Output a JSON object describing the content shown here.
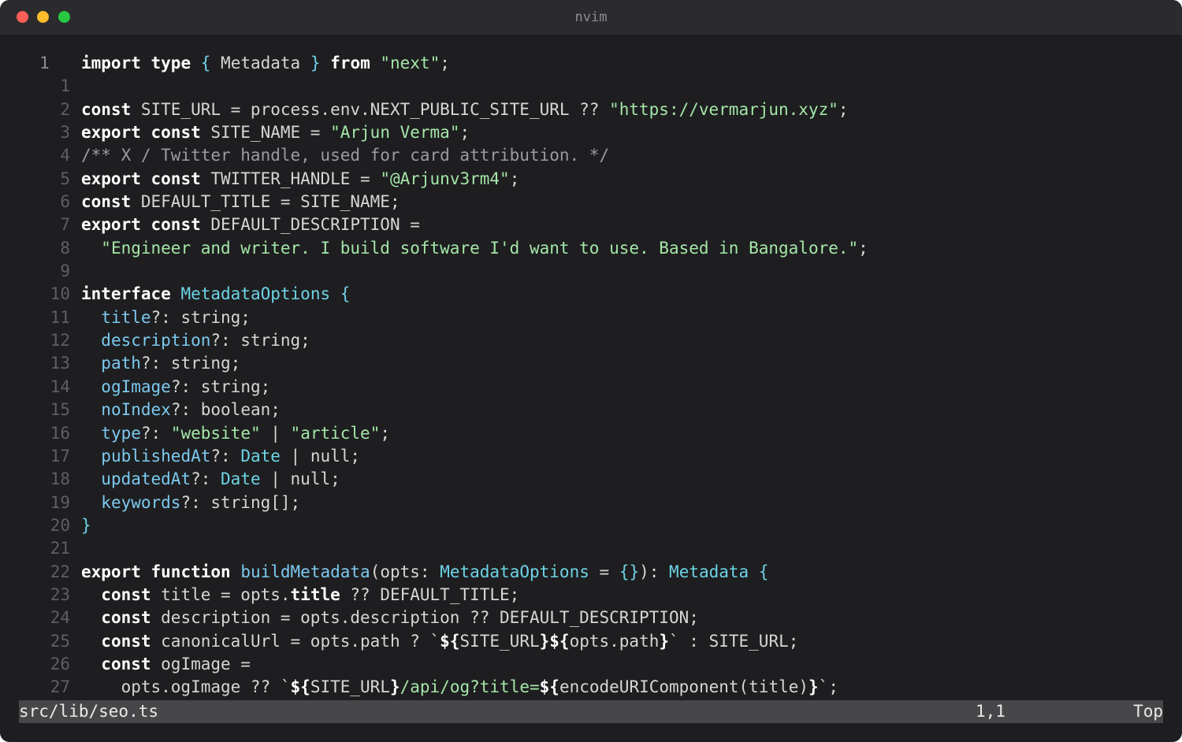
{
  "window": {
    "title": "nvim"
  },
  "editor": {
    "lines": [
      {
        "ln": "1",
        "parts": [
          [
            "kw",
            "import"
          ],
          [
            "",
            " "
          ],
          [
            "kw",
            "type"
          ],
          [
            "",
            " "
          ],
          [
            "br",
            "{"
          ],
          [
            "",
            " Metadata "
          ],
          [
            "br",
            "}"
          ],
          [
            "",
            " "
          ],
          [
            "kw",
            "from"
          ],
          [
            "",
            " "
          ],
          [
            "str",
            "\"next\""
          ],
          [
            "",
            ";"
          ]
        ]
      },
      {
        "ln": "1",
        "parts": []
      },
      {
        "ln": "2",
        "parts": [
          [
            "kw",
            "const"
          ],
          [
            "",
            " SITE_URL = process.env.NEXT_PUBLIC_SITE_URL ?? "
          ],
          [
            "str",
            "\"https://vermarjun.xyz\""
          ],
          [
            "",
            ";"
          ]
        ]
      },
      {
        "ln": "3",
        "parts": [
          [
            "kw",
            "export"
          ],
          [
            "",
            " "
          ],
          [
            "kw",
            "const"
          ],
          [
            "",
            " SITE_NAME = "
          ],
          [
            "str",
            "\"Arjun Verma\""
          ],
          [
            "",
            ";"
          ]
        ]
      },
      {
        "ln": "4",
        "parts": [
          [
            "cm",
            "/** X / Twitter handle, used for card attribution. */"
          ]
        ]
      },
      {
        "ln": "5",
        "parts": [
          [
            "kw",
            "export"
          ],
          [
            "",
            " "
          ],
          [
            "kw",
            "const"
          ],
          [
            "",
            " TWITTER_HANDLE = "
          ],
          [
            "str",
            "\"@Arjunv3rm4\""
          ],
          [
            "",
            ";"
          ]
        ]
      },
      {
        "ln": "6",
        "parts": [
          [
            "kw",
            "const"
          ],
          [
            "",
            " DEFAULT_TITLE = SITE_NAME;"
          ]
        ]
      },
      {
        "ln": "7",
        "parts": [
          [
            "kw",
            "export"
          ],
          [
            "",
            " "
          ],
          [
            "kw",
            "const"
          ],
          [
            "",
            " DEFAULT_DESCRIPTION ="
          ]
        ]
      },
      {
        "ln": "8",
        "parts": [
          [
            "",
            "  "
          ],
          [
            "str",
            "\"Engineer and writer. I build software I'd want to use. Based in Bangalore.\""
          ],
          [
            "",
            ";"
          ]
        ]
      },
      {
        "ln": "9",
        "parts": []
      },
      {
        "ln": "10",
        "parts": [
          [
            "kw",
            "interface"
          ],
          [
            "",
            " "
          ],
          [
            "ty",
            "MetadataOptions"
          ],
          [
            "",
            " "
          ],
          [
            "br",
            "{"
          ]
        ]
      },
      {
        "ln": "11",
        "parts": [
          [
            "",
            "  "
          ],
          [
            "prop",
            "title"
          ],
          [
            "",
            "?: string;"
          ]
        ]
      },
      {
        "ln": "12",
        "parts": [
          [
            "",
            "  "
          ],
          [
            "prop",
            "description"
          ],
          [
            "",
            "?: string;"
          ]
        ]
      },
      {
        "ln": "13",
        "parts": [
          [
            "",
            "  "
          ],
          [
            "prop",
            "path"
          ],
          [
            "",
            "?: string;"
          ]
        ]
      },
      {
        "ln": "14",
        "parts": [
          [
            "",
            "  "
          ],
          [
            "prop",
            "ogImage"
          ],
          [
            "",
            "?: string;"
          ]
        ]
      },
      {
        "ln": "15",
        "parts": [
          [
            "",
            "  "
          ],
          [
            "prop",
            "noIndex"
          ],
          [
            "",
            "?: boolean;"
          ]
        ]
      },
      {
        "ln": "16",
        "parts": [
          [
            "",
            "  "
          ],
          [
            "prop",
            "type"
          ],
          [
            "",
            "?: "
          ],
          [
            "str",
            "\"website\""
          ],
          [
            "",
            " | "
          ],
          [
            "str",
            "\"article\""
          ],
          [
            "",
            ";"
          ]
        ]
      },
      {
        "ln": "17",
        "parts": [
          [
            "",
            "  "
          ],
          [
            "prop",
            "publishedAt"
          ],
          [
            "",
            "?: "
          ],
          [
            "ty",
            "Date"
          ],
          [
            "",
            " | null;"
          ]
        ]
      },
      {
        "ln": "18",
        "parts": [
          [
            "",
            "  "
          ],
          [
            "prop",
            "updatedAt"
          ],
          [
            "",
            "?: "
          ],
          [
            "ty",
            "Date"
          ],
          [
            "",
            " | null;"
          ]
        ]
      },
      {
        "ln": "19",
        "parts": [
          [
            "",
            "  "
          ],
          [
            "prop",
            "keywords"
          ],
          [
            "",
            "?: string[];"
          ]
        ]
      },
      {
        "ln": "20",
        "parts": [
          [
            "br",
            "}"
          ]
        ]
      },
      {
        "ln": "21",
        "parts": []
      },
      {
        "ln": "22",
        "parts": [
          [
            "kw",
            "export"
          ],
          [
            "",
            " "
          ],
          [
            "kw",
            "function"
          ],
          [
            "",
            " "
          ],
          [
            "prop",
            "buildMetadata"
          ],
          [
            "",
            "(opts: "
          ],
          [
            "ty",
            "MetadataOptions"
          ],
          [
            "",
            " = "
          ],
          [
            "br",
            "{}"
          ],
          [
            "",
            "): "
          ],
          [
            "ty",
            "Metadata"
          ],
          [
            "",
            " "
          ],
          [
            "br",
            "{"
          ]
        ]
      },
      {
        "ln": "23",
        "parts": [
          [
            "",
            "  "
          ],
          [
            "kw",
            "const"
          ],
          [
            "",
            " title = opts."
          ],
          [
            "kw",
            "title"
          ],
          [
            "",
            " ?? DEFAULT_TITLE;"
          ]
        ]
      },
      {
        "ln": "24",
        "parts": [
          [
            "",
            "  "
          ],
          [
            "kw",
            "const"
          ],
          [
            "",
            " description = opts.description ?? DEFAULT_DESCRIPTION;"
          ]
        ]
      },
      {
        "ln": "25",
        "parts": [
          [
            "",
            "  "
          ],
          [
            "kw",
            "const"
          ],
          [
            "",
            " canonicalUrl = opts.path ? `"
          ],
          [
            "kw",
            "${"
          ],
          [
            "",
            "SITE_URL"
          ],
          [
            "kw",
            "}${"
          ],
          [
            "",
            "opts.path"
          ],
          [
            "kw",
            "}"
          ],
          [
            "",
            "` : SITE_URL;"
          ]
        ]
      },
      {
        "ln": "26",
        "parts": [
          [
            "",
            "  "
          ],
          [
            "kw",
            "const"
          ],
          [
            "",
            " ogImage ="
          ]
        ]
      },
      {
        "ln": "27",
        "parts": [
          [
            "",
            "    opts.ogImage ?? `"
          ],
          [
            "kw",
            "${"
          ],
          [
            "",
            "SITE_URL"
          ],
          [
            "kw",
            "}"
          ],
          [
            "str",
            "/api/og?title="
          ],
          [
            "kw",
            "${"
          ],
          [
            "",
            "encodeURIComponent(title)"
          ],
          [
            "kw",
            "}"
          ],
          [
            "",
            "`;"
          ]
        ]
      }
    ]
  },
  "status": {
    "file": "src/lib/seo.ts",
    "position": "1,1",
    "scroll": "Top"
  },
  "colors": {
    "background": "#1e1e20",
    "titlebar": "#2b2b2d",
    "statusbar": "#474749",
    "keyword": "#ffffff",
    "string": "#a4e6a8",
    "type": "#6dd4e6",
    "property": "#7cc9ef",
    "comment": "#9a9aa0"
  }
}
